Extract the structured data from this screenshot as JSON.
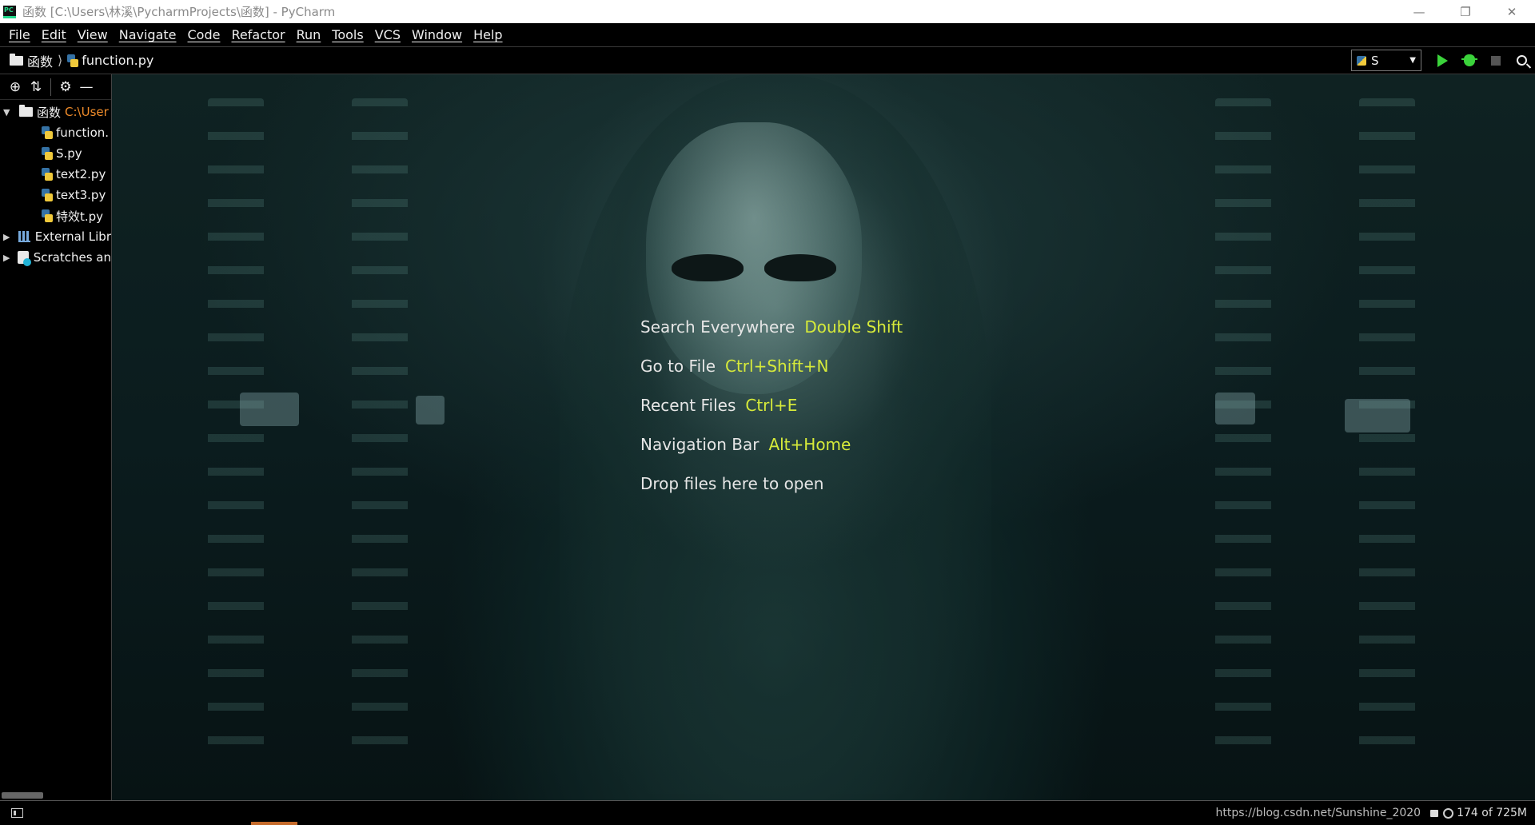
{
  "window": {
    "title": "函数 [C:\\Users\\林溪\\PycharmProjects\\函数] - PyCharm",
    "app_icon_text": "PC"
  },
  "menu": [
    "File",
    "Edit",
    "View",
    "Navigate",
    "Code",
    "Refactor",
    "Run",
    "Tools",
    "VCS",
    "Window",
    "Help"
  ],
  "navbar": {
    "project": "函数",
    "file": "function.py",
    "run_config": "S"
  },
  "project_tree": {
    "root": {
      "label": "函数",
      "path": "C:\\User"
    },
    "files": [
      "function.",
      "S.py",
      "text2.py",
      "text3.py",
      "特效t.py"
    ],
    "external_libraries": "External Libr",
    "scratches": "Scratches an"
  },
  "hints": [
    {
      "action": "Search Everywhere",
      "shortcut": "Double Shift"
    },
    {
      "action": "Go to File",
      "shortcut": "Ctrl+Shift+N"
    },
    {
      "action": "Recent Files",
      "shortcut": "Ctrl+E"
    },
    {
      "action": "Navigation Bar",
      "shortcut": "Alt+Home"
    },
    {
      "action": "Drop files here to open",
      "shortcut": ""
    }
  ],
  "status": {
    "watermark": "https://blog.csdn.net/Sunshine_2020",
    "memory": "174 of 725M"
  },
  "colors": {
    "shortcut_key": "#d6ea3a",
    "root_path": "#f08c2a",
    "run_green": "#3bd33b"
  }
}
